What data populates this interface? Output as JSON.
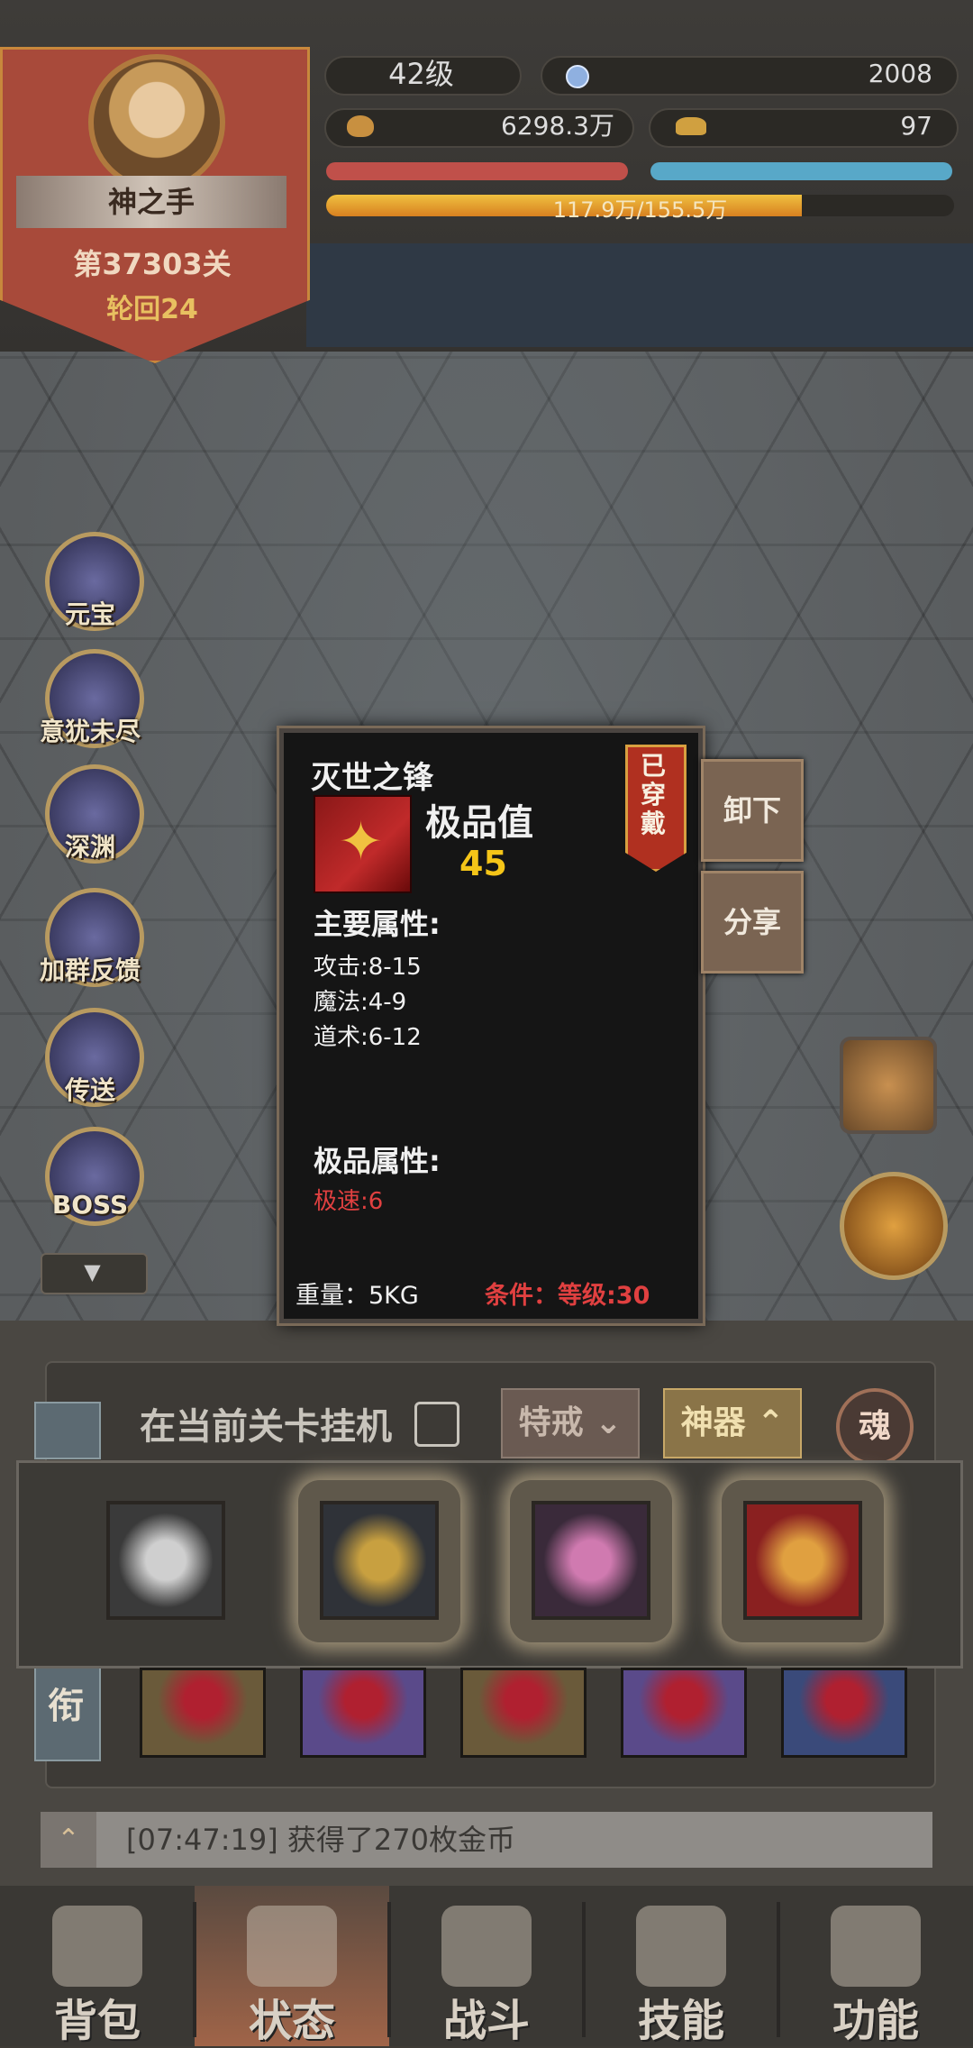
{
  "player": {
    "name": "神之手",
    "stage": "第37303关",
    "cycle": "轮回24",
    "level": "42级",
    "gems": "2008",
    "gold": "6298.3万",
    "ingots": "97",
    "exp_text": "117.9万/155.5万",
    "exp_progress": 0.758
  },
  "side_menu": [
    {
      "label": "元宝",
      "icon": "gold-ingot-icon"
    },
    {
      "label": "意犹未尽",
      "icon": "crystal-orb-icon"
    },
    {
      "label": "深渊",
      "icon": "abyss-icon"
    },
    {
      "label": "加群反馈",
      "icon": "feedback-icon"
    },
    {
      "label": "传送",
      "icon": "teleport-icon"
    },
    {
      "label": "BOSS",
      "icon": "boss-icon"
    }
  ],
  "side_scroll_icon": "▼",
  "item_popup": {
    "name": "灭世之锋",
    "quality_label": "极品值",
    "quality_value": "45",
    "worn_badge": "已穿戴",
    "main_attr_title": "主要属性:",
    "main_attrs": [
      "攻击:8-15",
      "魔法:4-9",
      "道术:6-12"
    ],
    "extreme_attr_title": "极品属性:",
    "extreme_attrs": [
      "极速:6"
    ],
    "weight": "重量：5KG",
    "condition": "条件：等级:30",
    "unequip_label": "卸下",
    "share_label": "分享"
  },
  "equip_panel": {
    "vertical_tab": "衔",
    "idle_label": "在当前关卡挂机",
    "special_label": "特戒",
    "artifact_label": "神器",
    "soul_label": "魂",
    "artifacts": [
      "silver-mask-icon",
      "golden-helm-icon",
      "pink-crystal-icon",
      "red-crossbow-icon"
    ],
    "gear": [
      "ruby-ring-icon",
      "ruby-ring-icon",
      "dragon-ring-icon",
      "dragon-ring-icon",
      "boots-icon"
    ]
  },
  "log": {
    "text": "[07:47:19] 获得了270枚金币"
  },
  "nav": [
    {
      "label": "背包",
      "icon": "bag-icon"
    },
    {
      "label": "状态",
      "icon": "status-icon"
    },
    {
      "label": "战斗",
      "icon": "battle-icon"
    },
    {
      "label": "技能",
      "icon": "skill-icon"
    },
    {
      "label": "功能",
      "icon": "function-icon"
    }
  ],
  "active_nav": 1
}
